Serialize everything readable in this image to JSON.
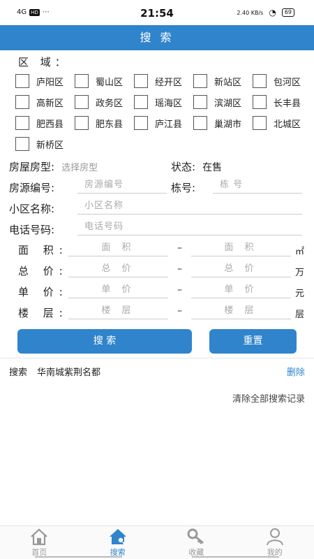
{
  "status": {
    "left_signal": "4G",
    "hd": "HD",
    "time": "21:54",
    "speed": "2.40 KB/s",
    "battery": "69"
  },
  "header": {
    "title": "搜 索"
  },
  "region": {
    "title": "区  域：",
    "districts": [
      "庐阳区",
      "蜀山区",
      "经开区",
      "新站区",
      "包河区",
      "高新区",
      "政务区",
      "瑶海区",
      "滨湖区",
      "长丰县",
      "肥西县",
      "肥东县",
      "庐江县",
      "巢湖市",
      "北城区",
      "新桥区"
    ]
  },
  "form": {
    "house_type_label": "房屋房型:",
    "house_type_placeholder": "选择房型",
    "status_label": "状态:",
    "status_value": "在售",
    "source_no_label": "房源编号:",
    "source_no_placeholder": "房源编号",
    "building_label": "栋号:",
    "building_placeholder": "栋  号",
    "community_label": "小区名称:",
    "community_placeholder": "小区名称",
    "phone_label": "电话号码:",
    "phone_placeholder": "电话号码"
  },
  "ranges": [
    {
      "label": "面 积:",
      "min": "面 积",
      "max": "面 积",
      "unit": "㎡"
    },
    {
      "label": "总 价:",
      "min": "总 价",
      "max": "总 价",
      "unit": "万"
    },
    {
      "label": "单 价:",
      "min": "单 价",
      "max": "单 价",
      "unit": "元"
    },
    {
      "label": "楼 层:",
      "min": "楼 层",
      "max": "楼 层",
      "unit": "层"
    }
  ],
  "range_dash": "–",
  "buttons": {
    "search": "搜  索",
    "reset": "重置"
  },
  "history": {
    "label": "搜索",
    "keyword": "华南城紫荆名都",
    "delete": "删除",
    "clear_all": "清除全部搜索记录"
  },
  "tabs": [
    {
      "label": "首页",
      "icon": "home-icon",
      "active": false
    },
    {
      "label": "搜索",
      "icon": "house-search-icon",
      "active": true
    },
    {
      "label": "收藏",
      "icon": "key-icon",
      "active": false
    },
    {
      "label": "我的",
      "icon": "user-icon",
      "active": false
    }
  ],
  "colors": {
    "accent": "#2f84cc",
    "placeholder": "#999999"
  }
}
